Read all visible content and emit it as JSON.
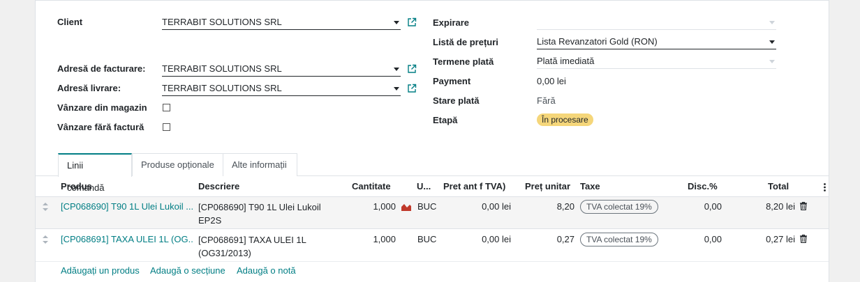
{
  "form": {
    "left": {
      "client": {
        "label": "Client",
        "value": "TERRABIT SOLUTIONS SRL"
      },
      "invoice_address": {
        "label": "Adresă de facturare:",
        "value": "TERRABIT SOLUTIONS SRL"
      },
      "delivery_address": {
        "label": "Adresă livrare:",
        "value": "TERRABIT SOLUTIONS SRL"
      },
      "store_sale": {
        "label": "Vânzare din magazin",
        "checked": false
      },
      "no_invoice_sale": {
        "label": "Vânzare fără factură",
        "checked": false
      }
    },
    "right": {
      "expiration": {
        "label": "Expirare",
        "value": ""
      },
      "pricelist": {
        "label": "Listă de prețuri",
        "value": "Lista Revanzatori Gold (RON)"
      },
      "payment_terms": {
        "label": "Termene plată",
        "value": "Plată imediată"
      },
      "payment": {
        "label": "Payment",
        "value": "0,00 lei"
      },
      "payment_state": {
        "label": "Stare plată",
        "value": "Fără"
      },
      "stage": {
        "label": "Etapă",
        "value": "În procesare",
        "color": "#f5d67a"
      }
    }
  },
  "tabs": [
    {
      "label": "Linii comandă",
      "active": true
    },
    {
      "label": "Produse opționale",
      "active": false
    },
    {
      "label": "Alte informații",
      "active": false
    }
  ],
  "table": {
    "headers": {
      "product": "Produs",
      "description": "Descriere",
      "quantity": "Cantitate",
      "uom": "U...",
      "price_before_vat": "Pret ant f TVA)",
      "unit_price": "Preț unitar",
      "taxes": "Taxe",
      "discount": "Disc.%",
      "total": "Total"
    },
    "rows": [
      {
        "product": "[CP068690] T90 1L Ulei Lukoil ...",
        "description_line1": "[CP068690] T90 1L Ulei Lukoil",
        "description_line2": "EP2S",
        "quantity": "1,000",
        "has_forecast_icon": true,
        "uom": "BUC",
        "price_before_vat": "0,00 lei",
        "unit_price": "8,20",
        "tax": "TVA colectat 19%",
        "discount": "0,00",
        "total": "8,20 lei"
      },
      {
        "product": "[CP068691] TAXA ULEI 1L (OG...",
        "description_line1": "[CP068691] TAXA ULEI 1L",
        "description_line2": "(OG31/2013)",
        "quantity": "1,000",
        "has_forecast_icon": false,
        "uom": "BUC",
        "price_before_vat": "0,00 lei",
        "unit_price": "0,27",
        "tax": "TVA colectat 19%",
        "discount": "0,00",
        "total": "0,27 lei"
      }
    ]
  },
  "actions": {
    "add_product": "Adăugați un produs",
    "add_section": "Adaugă o secțiune",
    "add_note": "Adaugă o notă"
  },
  "colors": {
    "accent": "#017e84",
    "badge": "#f5d67a",
    "chart_icon": "#c0392b"
  }
}
